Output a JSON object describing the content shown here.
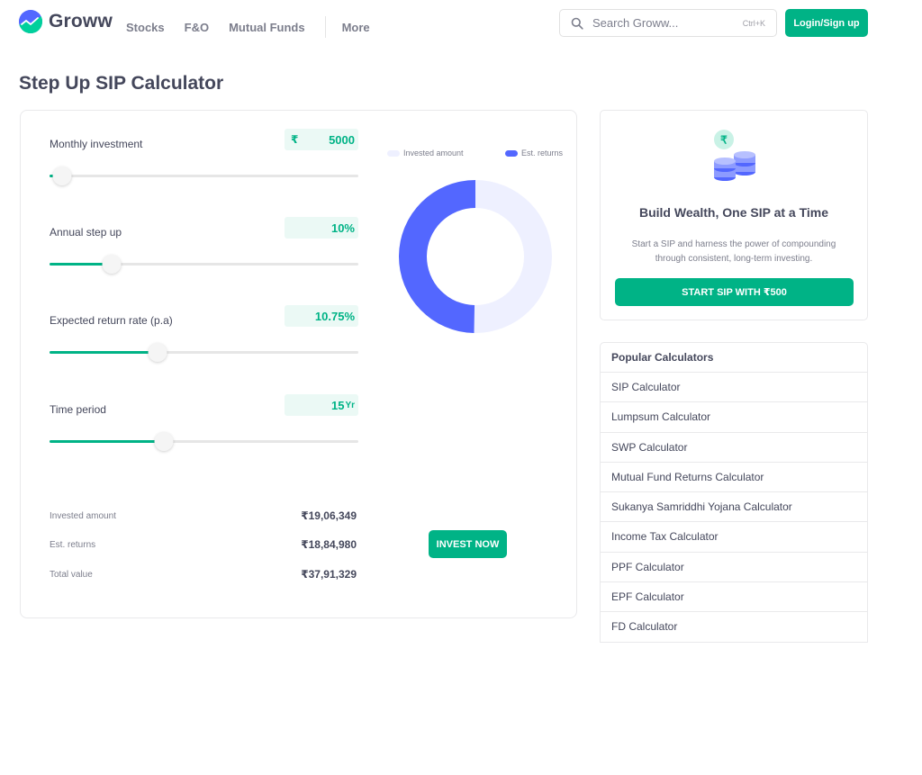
{
  "header": {
    "brand": "Groww",
    "nav": [
      "Stocks",
      "F&O",
      "Mutual Funds"
    ],
    "more": "More",
    "search_placeholder": "Search Groww...",
    "search_shortcut": "Ctrl+K",
    "login_label": "Login/Sign up"
  },
  "page": {
    "title": "Step Up SIP Calculator"
  },
  "calculator": {
    "fields": [
      {
        "label": "Monthly investment",
        "prefix": "₹",
        "value": "5000",
        "suffix": "",
        "slider_fraction": 0.04
      },
      {
        "label": "Annual step up",
        "prefix": "",
        "value": "10%",
        "suffix": "",
        "slider_fraction": 0.2
      },
      {
        "label": "Expected return rate (p.a)",
        "prefix": "",
        "value": "10.75%",
        "suffix": "",
        "slider_fraction": 0.35
      },
      {
        "label": "Time period",
        "prefix": "",
        "value": "15",
        "suffix": "Yr",
        "slider_fraction": 0.37
      }
    ],
    "legend": {
      "invested": "Invested amount",
      "returns": "Est. returns"
    },
    "chart_data": {
      "type": "pie",
      "categories": [
        "Invested amount",
        "Est. returns"
      ],
      "values": [
        1906349,
        1884980
      ],
      "colors": [
        "#eef0ff",
        "#5367ff"
      ]
    },
    "summary": [
      {
        "label": "Invested amount",
        "value": "₹19,06,349"
      },
      {
        "label": "Est. returns",
        "value": "₹18,84,980"
      },
      {
        "label": "Total value",
        "value": "₹37,91,329"
      }
    ],
    "invest_label": "INVEST NOW"
  },
  "promo": {
    "coin_symbol": "₹",
    "title": "Build Wealth, One SIP at a Time",
    "description": "Start a SIP and harness the power of compounding through consistent, long-term investing.",
    "button_label": "START SIP WITH ₹500"
  },
  "popular": {
    "title": "Popular Calculators",
    "items": [
      "SIP Calculator",
      "Lumpsum Calculator",
      "SWP Calculator",
      "Mutual Fund Returns Calculator",
      "Sukanya Samriddhi Yojana Calculator",
      "Income Tax Calculator",
      "PPF Calculator",
      "EPF Calculator",
      "FD Calculator"
    ]
  },
  "colors": {
    "accent": "#00b386",
    "returns": "#5367ff",
    "invested": "#eef0ff"
  }
}
